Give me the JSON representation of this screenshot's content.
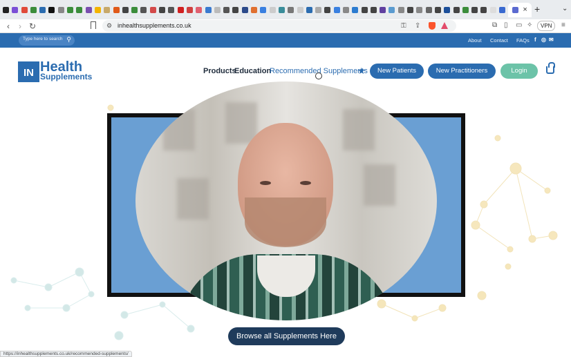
{
  "browser": {
    "url": "inhealthsupplements.co.uk",
    "vpn_label": "VPN",
    "new_tab": "+",
    "tab_close": "×",
    "tab_menu": "⌄"
  },
  "topbar": {
    "search_placeholder": "Type here to search",
    "links": [
      "About",
      "Contact",
      "FAQs"
    ],
    "social": [
      "f",
      "◎",
      "✉"
    ]
  },
  "logo": {
    "box": "IN",
    "line1": "Health",
    "line2": "Supplements"
  },
  "nav": {
    "products": "Products",
    "education": "Education",
    "recommended": "Recommended Supplements",
    "new_patients": "New Patients",
    "new_practitioners": "New Practitioners",
    "login": "Login"
  },
  "hero": {
    "browse_label": "Browse all Supplements Here"
  },
  "status_url": "https://inhealthsupplements.co.uk/recommended-supplements/",
  "colors": {
    "brand": "#2b6cb0",
    "login": "#6cc3a8",
    "browse": "#1f3b5b"
  }
}
